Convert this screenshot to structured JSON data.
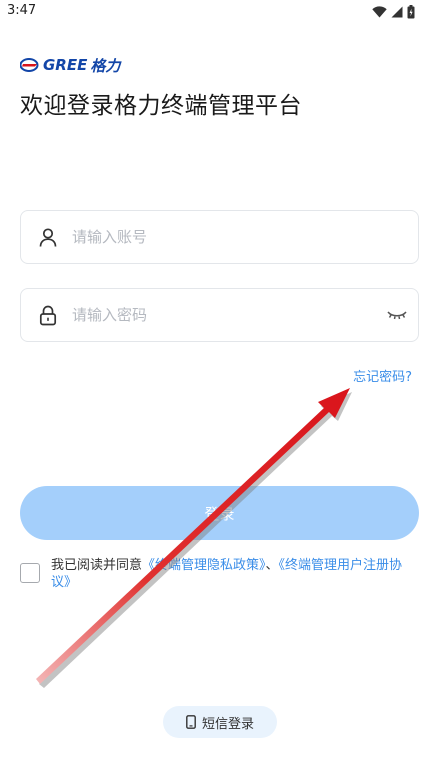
{
  "status_bar": {
    "time": "3:47"
  },
  "logo": {
    "brand_en": "GREE",
    "brand_cn": "格力"
  },
  "header": {
    "welcome": "欢迎登录格力终端管理平台"
  },
  "form": {
    "account_placeholder": "请输入账号",
    "password_placeholder": "请输入密码",
    "forgot_label": "忘记密码?",
    "login_label": "登录"
  },
  "agreement": {
    "prefix": "我已阅读并同意",
    "privacy_link": "《终端管理隐私政策》",
    "separator": "、",
    "terms_link": "《终端管理用户注册协议》"
  },
  "sms_login": {
    "label": "短信登录"
  },
  "colors": {
    "accent": "#3a8de8",
    "login_button": "#a4cffb",
    "brand": "#1346a8",
    "annotation_arrow": "#d9141b"
  }
}
